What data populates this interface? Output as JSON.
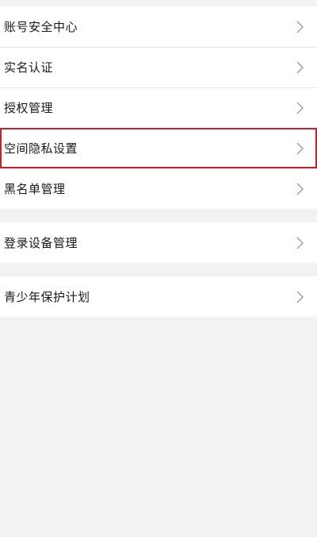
{
  "groups": [
    {
      "items": [
        {
          "label": "账号安全中心",
          "icon": "chevron-right-icon"
        },
        {
          "label": "实名认证",
          "icon": "chevron-right-icon"
        },
        {
          "label": "授权管理",
          "icon": "chevron-right-icon"
        },
        {
          "label": "空间隐私设置",
          "icon": "chevron-right-icon",
          "highlighted": true
        },
        {
          "label": "黑名单管理",
          "icon": "chevron-right-icon"
        }
      ]
    },
    {
      "items": [
        {
          "label": "登录设备管理",
          "icon": "chevron-right-icon"
        }
      ]
    },
    {
      "items": [
        {
          "label": "青少年保护计划",
          "icon": "chevron-right-icon"
        }
      ]
    }
  ],
  "colors": {
    "highlight_border": "#cc1f2d",
    "background": "#f2f2f2",
    "row_background": "#ffffff",
    "chevron": "#9a9a9a"
  }
}
